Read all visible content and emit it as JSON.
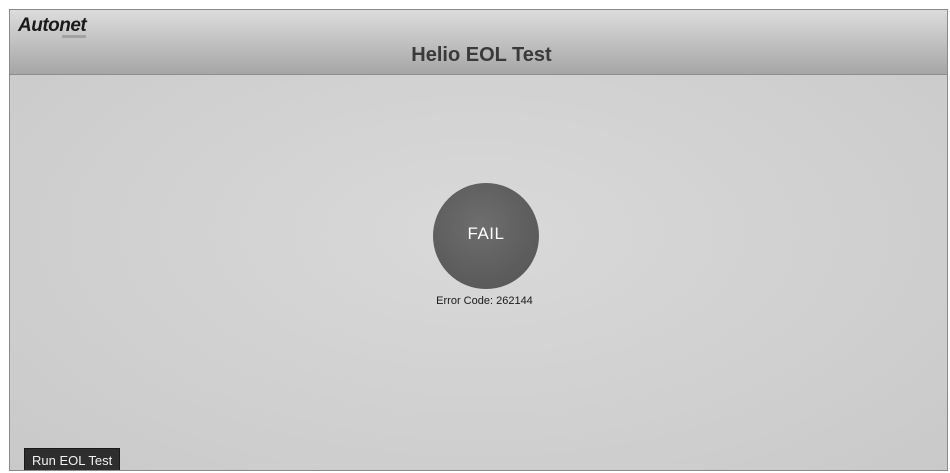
{
  "app": {
    "logo_text": "Autonet",
    "title": "Helio EOL Test"
  },
  "result": {
    "status": "FAIL",
    "error_label": "Error Code:",
    "error_code": "262144",
    "circle_color": "#5f5f5f"
  },
  "controls": {
    "run_button_label": "Run EOL Test"
  }
}
